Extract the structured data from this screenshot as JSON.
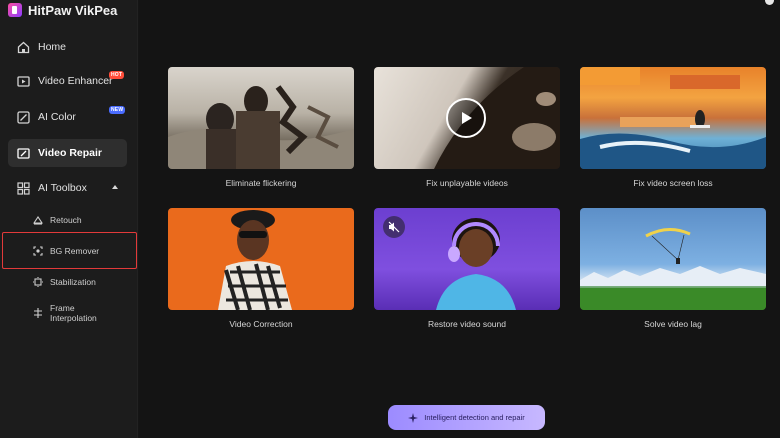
{
  "app": {
    "title": "HitPaw VikPea"
  },
  "sidebar": {
    "items": [
      {
        "label": "Home"
      },
      {
        "label": "Video Enhancer",
        "badge": "HOT"
      },
      {
        "label": "AI Color",
        "badge": "NEW"
      },
      {
        "label": "Video Repair",
        "active": true
      },
      {
        "label": "AI Toolbox",
        "expanded": true
      }
    ],
    "toolbox": [
      {
        "label": "Retouch"
      },
      {
        "label": "BG Remover",
        "highlighted": true
      },
      {
        "label": "Stabilization"
      },
      {
        "label": "Frame Interpolation",
        "line1": "Frame",
        "line2": "Interpolation"
      }
    ]
  },
  "main": {
    "cards": [
      {
        "caption": "Eliminate flickering"
      },
      {
        "caption": "Fix unplayable videos"
      },
      {
        "caption": "Fix video screen loss"
      },
      {
        "caption": "Video Correction"
      },
      {
        "caption": "Restore video sound"
      },
      {
        "caption": "Solve video lag"
      }
    ],
    "action_button": "Intelligent detection and repair"
  },
  "colors": {
    "accent": "#9c8bff",
    "highlight_border": "#e23a3a",
    "hot_badge": "#ff4d3a",
    "new_badge": "#4a6cff"
  },
  "icons": [
    "home-icon",
    "video-enhancer-icon",
    "ai-color-icon",
    "video-repair-icon",
    "ai-toolbox-icon",
    "retouch-icon",
    "bg-remover-icon",
    "stabilization-icon",
    "frame-interpolation-icon",
    "play-icon",
    "mute-icon",
    "sparkle-icon"
  ]
}
